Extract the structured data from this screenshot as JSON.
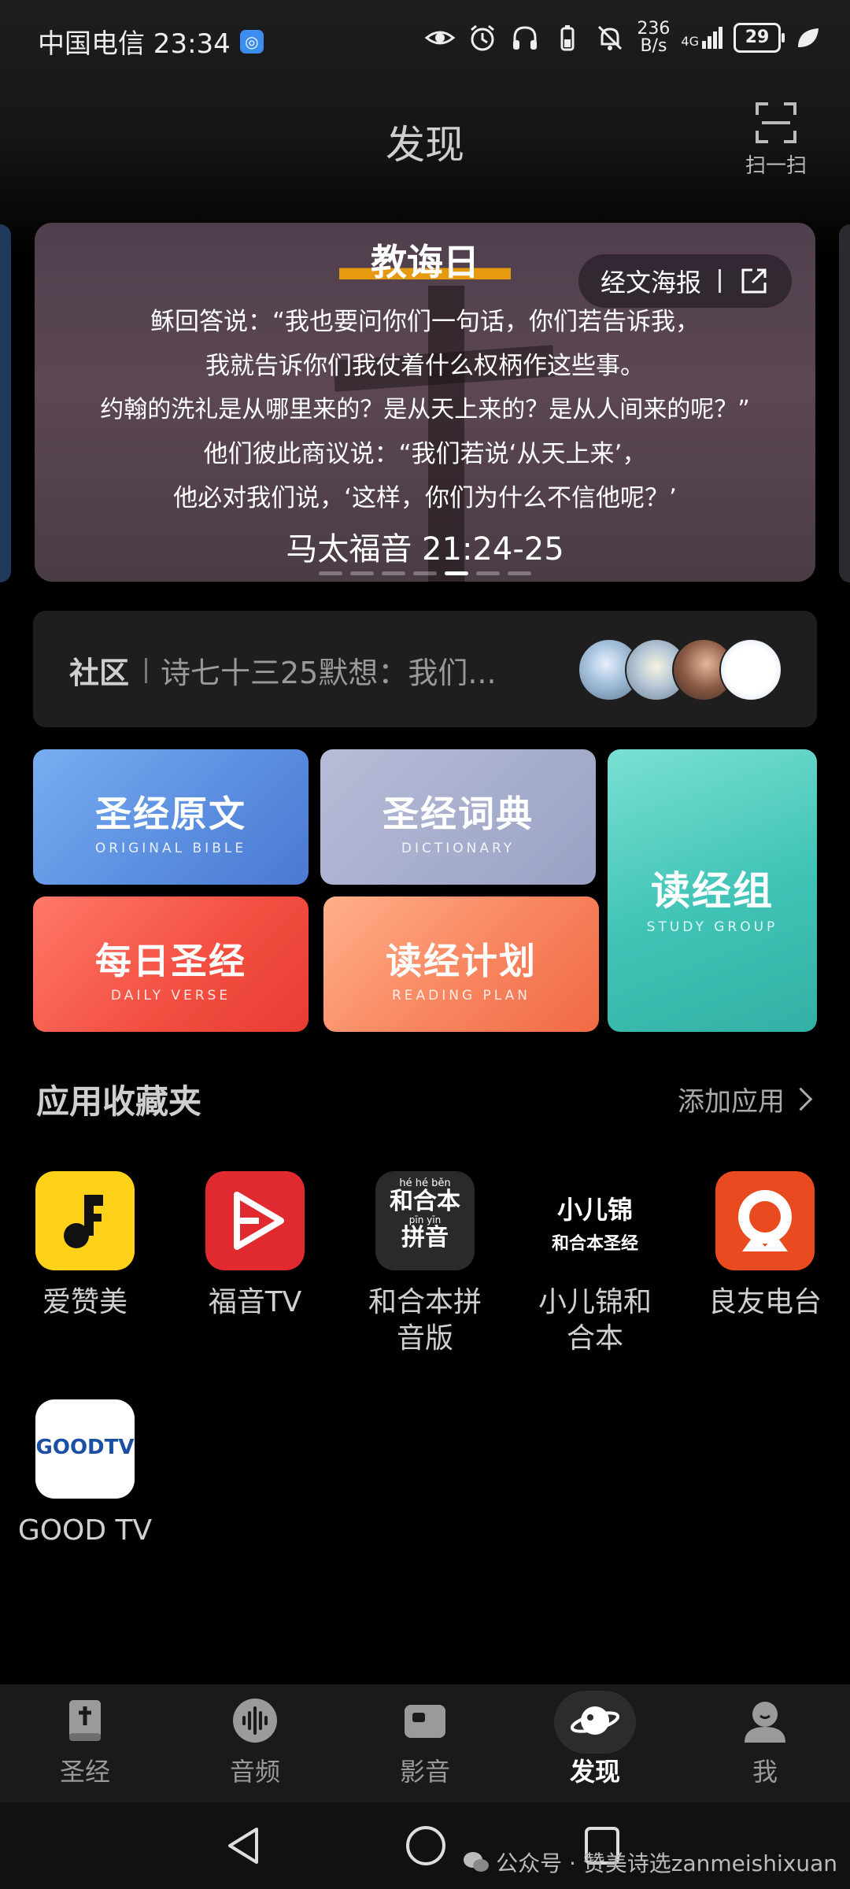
{
  "status_bar": {
    "carrier_time": "中国电信 23:34",
    "net_speed_top": "236",
    "net_speed_bottom": "B/s",
    "signal": "4G",
    "battery": "29"
  },
  "header": {
    "title": "发现",
    "scan_label": "扫一扫"
  },
  "banner": {
    "title": "教诲日",
    "poster_button": "经文海报",
    "verse_lines": [
      "稣回答说：“我也要问你们一句话，你们若告诉我，",
      "我就告诉你们我仗着什么权柄作这些事。",
      "约翰的洗礼是从哪里来的？是从天上来的？是从人间来的呢？”",
      "他们彼此商议说：“我们若说‘从天上来’，",
      "他必对我们说，‘这样，你们为什么不信他呢？’"
    ],
    "reference": "马太福音 21:24-25",
    "page_count": 7,
    "active_page": 5
  },
  "community": {
    "label": "社区",
    "preview": "诗七十三25默想：我们..."
  },
  "tiles": {
    "bible": {
      "cn": "圣经原文",
      "en": "ORIGINAL BIBLE"
    },
    "dictionary": {
      "cn": "圣经词典",
      "en": "DICTIONARY"
    },
    "daily": {
      "cn": "每日圣经",
      "en": "DAILY VERSE"
    },
    "plan": {
      "cn": "读经计划",
      "en": "READING PLAN"
    },
    "group": {
      "cn": "读经组",
      "en": "STUDY GROUP"
    }
  },
  "favorites": {
    "title": "应用收藏夹",
    "add_label": "添加应用",
    "apps": [
      {
        "label": "爱赞美",
        "color": "#ffd21a"
      },
      {
        "label": "福音TV",
        "color": "#e02a2f"
      },
      {
        "label": "和合本拼音版",
        "icon_text_top": "hé hé běn",
        "icon_text_mid": "和合本",
        "icon_text_pin": "pīn yīn",
        "icon_text_bottom": "拼音"
      },
      {
        "label": "小儿锦和合本",
        "icon_text_top": "小儿锦",
        "icon_text_bottom": "和合本圣经"
      },
      {
        "label": "良友电台",
        "color": "#ea4a1f"
      },
      {
        "label": "GOOD TV",
        "icon_text": "GOODTV"
      }
    ]
  },
  "bottom_nav": {
    "tabs": [
      {
        "label": "圣经"
      },
      {
        "label": "音频"
      },
      {
        "label": "影音"
      },
      {
        "label": "发现"
      },
      {
        "label": "我"
      }
    ],
    "active": "发现"
  },
  "watermark": "公众号 · 赞美诗选zanmeishixuan"
}
